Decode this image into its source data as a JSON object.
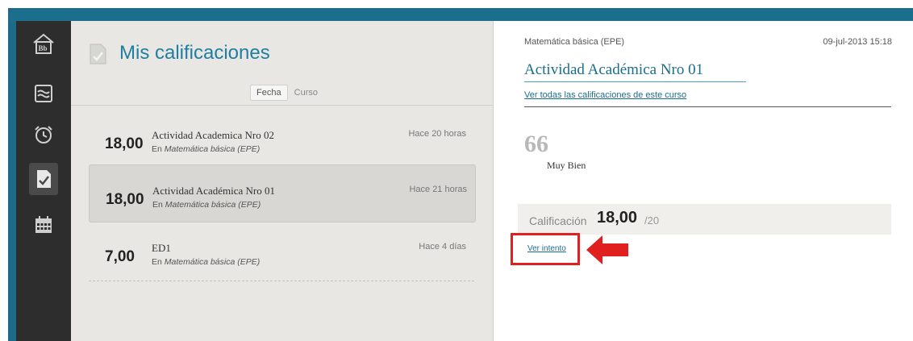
{
  "sidebar": {
    "items": [
      {
        "icon": "bb-home-icon"
      },
      {
        "icon": "stream-icon"
      },
      {
        "icon": "alarm-clock-icon"
      },
      {
        "icon": "grades-icon",
        "active": true
      },
      {
        "icon": "calendar-icon"
      }
    ]
  },
  "grades_panel": {
    "title": "Mis calificaciones",
    "sort": {
      "active": "Fecha",
      "other": "Curso"
    },
    "items": [
      {
        "score": "18,00",
        "name": "Actividad Academica Nro 02",
        "course_prefix": "En",
        "course": "Matemática básica (EPE)",
        "time": "Hace 20 horas"
      },
      {
        "score": "18,00",
        "name": "Actividad Académica Nro 01",
        "course_prefix": "En",
        "course": "Matemática básica (EPE)",
        "time": "Hace 21 horas",
        "selected": true
      },
      {
        "score": "7,00",
        "name": "ED1",
        "course_prefix": "En",
        "course": "Matemática básica (EPE)",
        "time": "Hace 4 días"
      }
    ]
  },
  "detail": {
    "course": "Matemática básica (EPE)",
    "date": "09-jul-2013 15:18",
    "title": "Actividad Académica Nro 01",
    "all_grades_link": "Ver todas las calificaciones de este curso",
    "quote_mark": "66",
    "feedback": "Muy Bien",
    "grade_label": "Calificación",
    "grade_value": "18,00",
    "grade_max": "/20",
    "attempt_link": "Ver intento"
  },
  "colors": {
    "accent": "#1f7fa1",
    "highlight": "#e01f1f",
    "frame": "#1d6b86"
  }
}
